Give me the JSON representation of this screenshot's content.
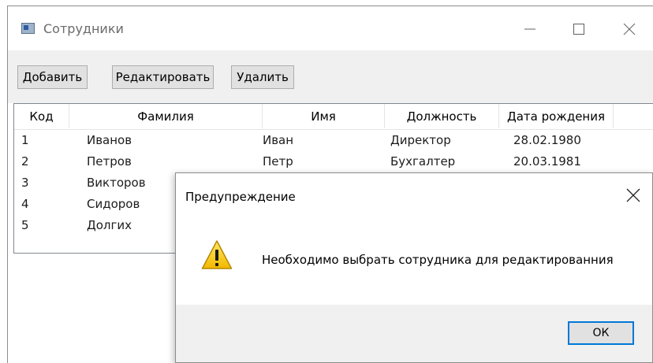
{
  "window": {
    "title": "Сотрудники"
  },
  "toolbar": {
    "add_label": "Добавить",
    "edit_label": "Редактировать",
    "delete_label": "Удалить"
  },
  "grid": {
    "columns": [
      "Код",
      "Фамилия",
      "Имя",
      "Должность",
      "Дата рождения"
    ],
    "rows": [
      [
        "1",
        "Иванов",
        "Иван",
        "Директор",
        "28.02.1980"
      ],
      [
        "2",
        "Петров",
        "Петр",
        "Бухгалтер",
        "20.03.1981"
      ],
      [
        "3",
        "Викторов",
        "",
        "",
        ""
      ],
      [
        "4",
        "Сидоров",
        "",
        "",
        ""
      ],
      [
        "5",
        "Долгих",
        "",
        "",
        ""
      ]
    ]
  },
  "dialog": {
    "title": "Предупреждение",
    "message": "Необходимо выбрать сотрудника для редактированния",
    "ok_label": "ОК"
  },
  "icons": {
    "app": "window-app-icon",
    "minimize": "minimize-icon",
    "maximize": "maximize-icon",
    "close": "close-icon",
    "warning": "warning-icon"
  },
  "colors": {
    "focus_border": "#0078d7",
    "toolbar_bg": "#f0f0f0",
    "warning_yellow": "#f5c400"
  }
}
